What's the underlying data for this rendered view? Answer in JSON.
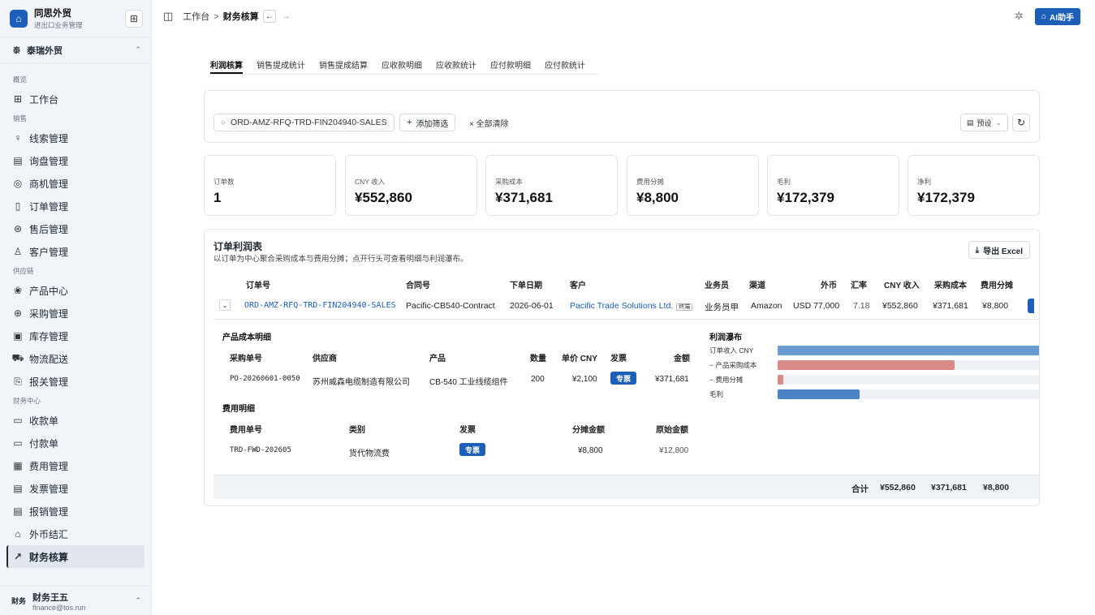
{
  "brand": {
    "title": "同思外贸",
    "subtitle": "进出口业务管理"
  },
  "org": {
    "badge": "泰",
    "name": "泰瑞外贸"
  },
  "nav": {
    "group_overview": "概览",
    "workbench": "工作台",
    "group_sales": "销售",
    "leads": "线索管理",
    "inquiry": "询盘管理",
    "opportunity": "商机管理",
    "orders": "订单管理",
    "aftersales": "售后管理",
    "customers": "客户管理",
    "group_supply": "供应链",
    "products": "产品中心",
    "purchase": "采购管理",
    "inventory": "库存管理",
    "logistics": "物流配送",
    "customs": "报关管理",
    "group_finance": "财务中心",
    "receipts": "收款单",
    "payments": "付款单",
    "expenses": "费用管理",
    "invoices": "发票管理",
    "reimburse": "报销管理",
    "fx": "外币结汇",
    "accounting": "财务核算"
  },
  "user": {
    "badge": "财务",
    "name": "财务王五",
    "email": "finance@tos.run"
  },
  "topbar": {
    "crumb_root": "工作台",
    "crumb_sep": ">",
    "crumb_current": "财务核算",
    "ai_label": "AI助手"
  },
  "tabs": [
    "利润核算",
    "销售提成统计",
    "销售提成结算",
    "应收款明细",
    "应收款统计",
    "应付款明细",
    "应付款统计"
  ],
  "filter": {
    "search_value": "ORD-AMZ-RFQ-TRD-FIN204940-SALES",
    "add_label": "添加筛选",
    "clear_label": "全部清除",
    "preset_label": "预设"
  },
  "stats": [
    {
      "label": "订单数",
      "value": "1"
    },
    {
      "label": "CNY 收入",
      "value": "¥552,860"
    },
    {
      "label": "采购成本",
      "value": "¥371,681"
    },
    {
      "label": "费用分摊",
      "value": "¥8,800"
    },
    {
      "label": "毛利",
      "value": "¥172,379"
    },
    {
      "label": "净利",
      "value": "¥172,379"
    }
  ],
  "profit_table": {
    "title": "订单利润表",
    "subtitle": "以订单为中心聚合采购成本与费用分摊；点开行头可查看明细与利润瀑布。",
    "export_label": "导出 Excel",
    "headers": {
      "order_no": "订单号",
      "contract_no": "合同号",
      "order_date": "下单日期",
      "customer": "客户",
      "salesperson": "业务员",
      "channel": "渠道",
      "fx_amount": "外币",
      "rate": "汇率",
      "cny_income": "CNY 收入",
      "purchase_cost": "采购成本",
      "expense_alloc": "费用分摊"
    },
    "row": {
      "order_no": "ORD-AMZ-RFQ-TRD-FIN204940-SALES",
      "contract_no": "Pacific-CB540-Contract",
      "order_date": "2026-06-01",
      "customer": "Pacific Trade Solutions Ltd.",
      "customer_tag": "终端",
      "salesperson": "业务员甲",
      "channel": "Amazon",
      "fx_amount": "USD 77,000",
      "rate": "7.18",
      "cny_income": "¥552,860",
      "purchase_cost": "¥371,681",
      "expense_alloc": "¥8,800"
    },
    "product_cost": {
      "title": "产品成本明细",
      "headers": {
        "po": "采购单号",
        "supplier": "供应商",
        "product": "产品",
        "qty": "数量",
        "unit_price": "单价 CNY",
        "invoice": "发票",
        "amount": "金额"
      },
      "row": {
        "po": "PO-20260601-0050",
        "supplier": "苏州威森电缆制造有限公司",
        "product": "CB-540 工业线缆组件",
        "qty": "200",
        "unit_price": "¥2,100",
        "invoice": "专票",
        "amount": "¥371,681"
      }
    },
    "expense_detail": {
      "title": "费用明细",
      "headers": {
        "no": "费用单号",
        "category": "类别",
        "invoice": "发票",
        "alloc": "分摊金额",
        "original": "原始金额"
      },
      "row": {
        "no": "TRD-FWD-202605",
        "category": "货代物流费",
        "invoice": "专票",
        "alloc": "¥8,800",
        "original": "¥12,800"
      }
    },
    "waterfall": {
      "title": "利润瀑布",
      "items": [
        {
          "label": "订单收入 CNY",
          "value": 552860,
          "color": "#6a9ccf"
        },
        {
          "label": "− 产品采购成本",
          "value": 371681,
          "color": "#d98a86"
        },
        {
          "label": "− 费用分摊",
          "value": 8800,
          "color": "#d98a86"
        },
        {
          "label": "毛利",
          "value": 172379,
          "color": "#4a84c4"
        }
      ]
    },
    "total": {
      "label": "合计",
      "cny_income": "¥552,860",
      "purchase_cost": "¥371,681",
      "expense_alloc": "¥8,800"
    }
  }
}
